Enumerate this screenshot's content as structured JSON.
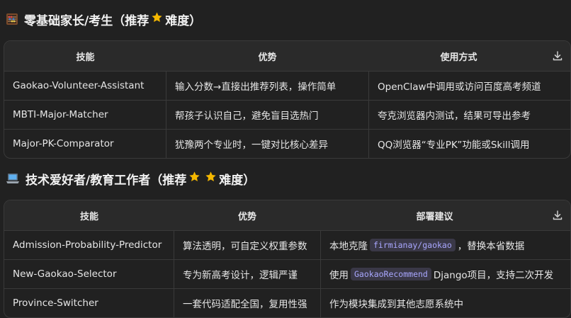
{
  "section1": {
    "title": "零基础家长/考生（推荐",
    "title_suffix": "难度）",
    "stars": 1,
    "headers": [
      "技能",
      "优势",
      "使用方式"
    ],
    "rows": [
      [
        "Gaokao-Volunteer-Assistant",
        "输入分数→直接出推荐列表，操作简单",
        "OpenClaw中调用或访问百度高考频道"
      ],
      [
        "MBTI-Major-Matcher",
        "帮孩子认识自己，避免盲目选热门",
        "夸克浏览器内测试，结果可导出参考"
      ],
      [
        "Major-PK-Comparator",
        "犹豫两个专业时，一键对比核心差异",
        "QQ浏览器“专业PK”功能或Skill调用"
      ]
    ]
  },
  "section2": {
    "title": "技术爱好者/教育工作者（推荐",
    "title_suffix": "难度）",
    "stars": 2,
    "headers": [
      "技能",
      "优势",
      "部署建议"
    ],
    "rows": [
      {
        "c1": "Admission-Probability-Predictor",
        "c2": "算法透明，可自定义权重参数",
        "c3_pre": "本地克隆",
        "c3_code": "firmianay/gaokao",
        "c3_post": "，替换本省数据"
      },
      {
        "c1": "New-Gaokao-Selector",
        "c2": "专为新高考设计，逻辑严谨",
        "c3_pre": "使用",
        "c3_code": "GaokaoRecommend",
        "c3_post": "Django项目，支持二次开发"
      },
      {
        "c1": "Province-Switcher",
        "c2": "一套代码适配全国，复用性强",
        "c3_pre": "作为模块集成到其他志愿系统中",
        "c3_code": "",
        "c3_post": ""
      }
    ]
  },
  "icons": {
    "section1_emoji": "abacus-icon",
    "section2_emoji": "laptop-icon",
    "star": "star-icon",
    "download": "download-icon"
  },
  "colors": {
    "background": "#212121",
    "header_bg": "#2a2a2a",
    "border": "#3a3a3a",
    "code_text": "#a9a7ff",
    "code_bg": "#3a3847",
    "star": "#f5b800"
  }
}
